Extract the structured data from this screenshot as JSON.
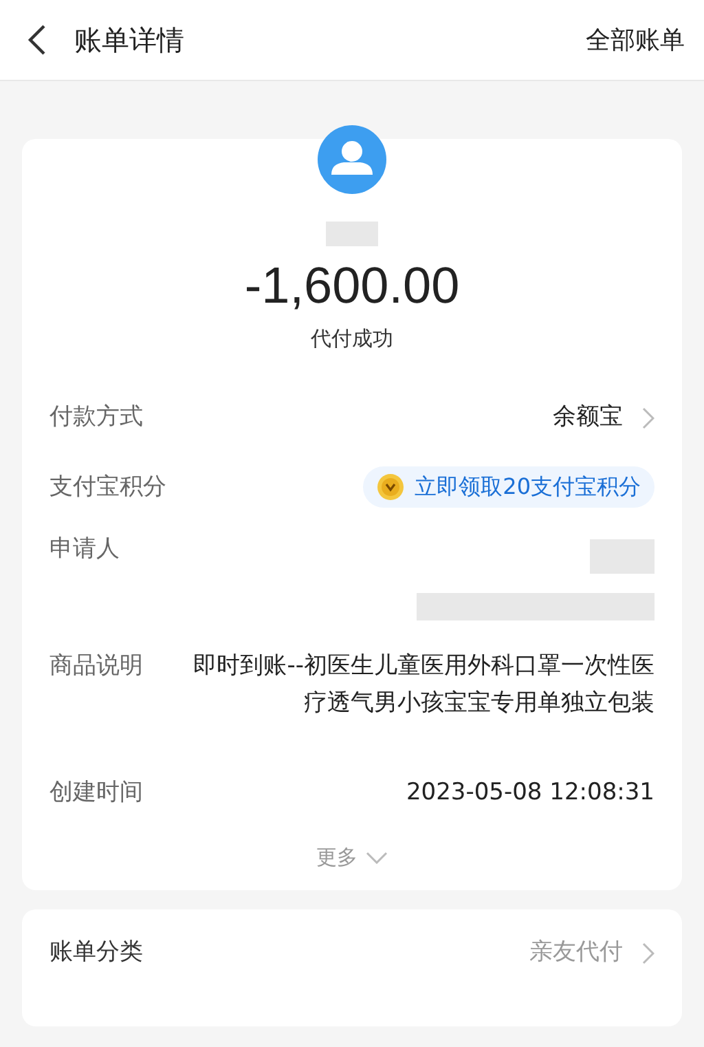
{
  "header": {
    "title": "账单详情",
    "action": "全部账单"
  },
  "summary": {
    "amount": "-1,600.00",
    "status": "代付成功"
  },
  "details": [
    {
      "kind": "link",
      "label": "付款方式",
      "value": "余额宝"
    },
    {
      "kind": "promo",
      "label": "支付宝积分",
      "value": "立即领取20支付宝积分"
    },
    {
      "kind": "redacted",
      "label": "申请人"
    },
    {
      "kind": "text",
      "label": "商品说明",
      "value": "即时到账--初医生儿童医用外科口罩一次性医疗透气男小孩宝宝专用单独立包装"
    },
    {
      "kind": "text",
      "label": "创建时间",
      "value": "2023-05-08 12:08:31"
    }
  ],
  "more": "更多",
  "category": {
    "label": "账单分类",
    "value": "亲友代付"
  }
}
